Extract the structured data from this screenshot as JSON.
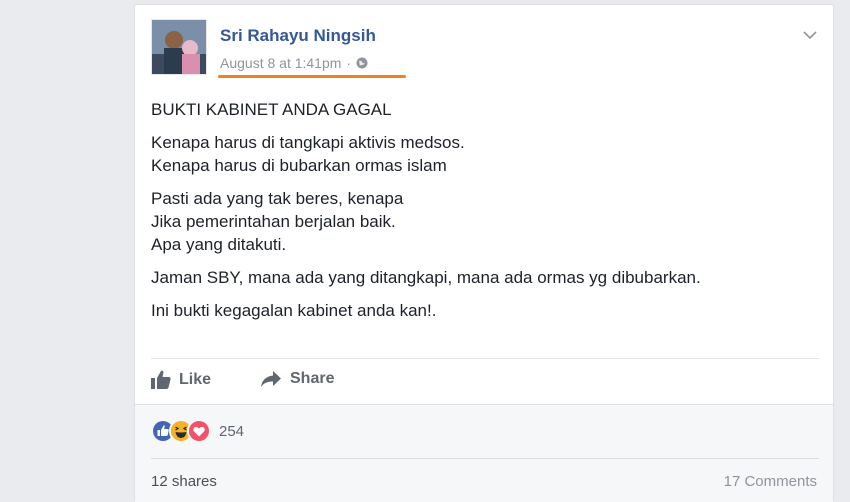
{
  "post": {
    "author": "Sri Rahayu Ningsih",
    "timestamp": "August 8 at 1:41pm",
    "separator": "·",
    "privacy_icon": "globe-icon",
    "options_icon": "chevron-down-icon",
    "lines": [
      "BUKTI KABINET ANDA GAGAL",
      "Kenapa harus di tangkapi aktivis medsos.",
      "Kenapa harus di bubarkan ormas islam",
      "Pasti ada yang tak beres, kenapa",
      "Jika pemerintahan berjalan baik.",
      "Apa yang ditakuti.",
      "Jaman SBY, mana ada yang ditangkapi, mana ada ormas yg dibubarkan.",
      "Ini bukti kegagalan kabinet anda kan!."
    ]
  },
  "actions": {
    "like_label": "Like",
    "like_icon": "thumbs-up-icon",
    "share_label": "Share",
    "share_icon": "share-arrow-icon"
  },
  "reactions": {
    "icons": [
      "like-reaction-icon",
      "haha-reaction-icon",
      "love-reaction-icon"
    ],
    "count": "254"
  },
  "footer": {
    "shares": "12 shares",
    "comments": "17 Comments"
  },
  "colors": {
    "link_blue": "#365899",
    "highlight_underline": "#f28022",
    "like_blue": "#4267b2",
    "haha_yellow": "#f7b125",
    "love_red": "#f25268"
  }
}
